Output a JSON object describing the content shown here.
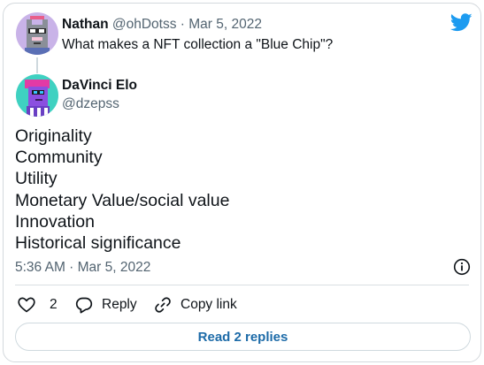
{
  "parent_tweet": {
    "author_name": "Nathan",
    "author_handle": "@ohDotss",
    "separator": "·",
    "date": "Mar 5, 2022",
    "text": "What makes a NFT collection a \"Blue Chip\"?",
    "avatar_icon": "pixel-cat-avatar-icon"
  },
  "reply_tweet": {
    "author_name": "DaVinci Elo",
    "author_handle": "@dzepss",
    "avatar_icon": "pixel-punk-avatar-icon",
    "lines": [
      "Originality",
      "Community",
      "Utility",
      "Monetary Value/social value",
      "Innovation",
      "Historical significance"
    ],
    "timestamp": "5:36 AM · Mar 5, 2022"
  },
  "actions": {
    "like_count": "2",
    "reply_label": "Reply",
    "copy_link_label": "Copy link"
  },
  "read_replies_label": "Read 2 replies",
  "colors": {
    "twitter_blue": "#1d9bf0",
    "link_blue": "#1d6ba8",
    "muted_text": "#536471",
    "border": "#cfd9de"
  }
}
